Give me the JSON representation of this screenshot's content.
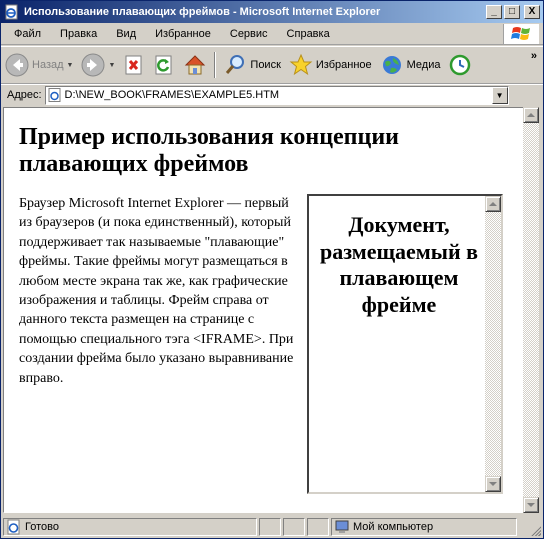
{
  "window": {
    "title": "Использование плавающих фреймов - Microsoft Internet Explorer",
    "minimize_glyph": "_",
    "maximize_glyph": "□",
    "close_glyph": "X"
  },
  "menu": {
    "items": [
      {
        "label": "Файл"
      },
      {
        "label": "Правка"
      },
      {
        "label": "Вид"
      },
      {
        "label": "Избранное"
      },
      {
        "label": "Сервис"
      },
      {
        "label": "Справка"
      }
    ]
  },
  "toolbar": {
    "back_label": "Назад",
    "search_label": "Поиск",
    "favorites_label": "Избранное",
    "media_label": "Медиа",
    "more_glyph": "»"
  },
  "address": {
    "label": "Адрес:",
    "value": "D:\\NEW_BOOK\\FRAMES\\EXAMPLE5.HTM"
  },
  "page": {
    "title": "Пример использования концепции плавающих фреймов",
    "body": "Браузер Microsoft Internet Explorer — первый из браузеров (и пока единственный), который поддерживает так называемые \"плавающие\" фреймы. Такие фреймы могут размещаться в любом месте экрана так же, как графические изображения и таблицы. Фрейм справа от данного текста размещен на странице с помощью специального тэга <IFRAME>. При создании фрейма было указано выравнивание вправо."
  },
  "iframe": {
    "heading": "Документ, размещаемый в плавающем фрейме"
  },
  "status": {
    "text": "Готово",
    "zone": "Мой компьютер"
  },
  "colors": {
    "titlebar_start": "#0a246a",
    "titlebar_end": "#a6caf0",
    "chrome": "#d4d0c8"
  }
}
